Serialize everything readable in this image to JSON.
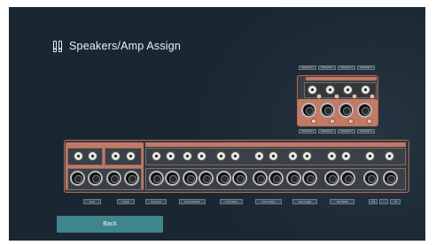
{
  "screen": {
    "title": "Speakers/Amp Assign",
    "title_icon": "speaker-pair-icon"
  },
  "amp_unit": {
    "top_labels": [
      "Subwoofer 1",
      "Subwoofer 2",
      "Subwoofer 3",
      "Subwoofer 4"
    ],
    "bottom_labels": [
      "Subwoofer 1",
      "Subwoofer 2",
      "Subwoofer 3",
      "Subwoofer 4"
    ],
    "rca_numbers": [
      "1",
      "2",
      "3",
      "4"
    ],
    "xlr_numbers": [
      "1",
      "2",
      "3",
      "4"
    ]
  },
  "main_unit": {
    "channel_labels": [
      "Front",
      "Center",
      "Surround",
      "Surround Back",
      "Front Wide",
      "Front Height",
      "Rear Height",
      "Top Middle",
      "SW",
      "/",
      "TR"
    ]
  },
  "footer": {
    "back_label": "Back"
  },
  "colors": {
    "background": "#1a2631",
    "accent_copper": "#c17a66",
    "button_teal": "#3f858c"
  }
}
